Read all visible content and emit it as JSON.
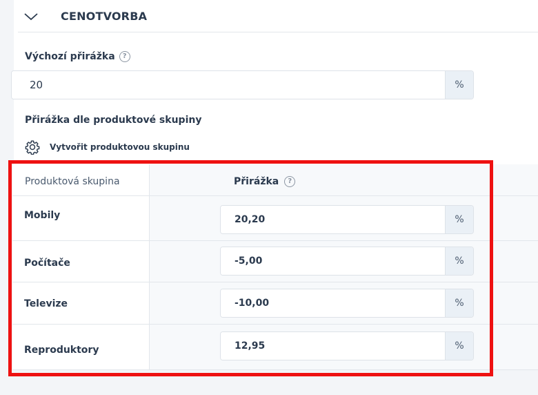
{
  "section": {
    "title": "CENOTVORBA",
    "toggle_icon": "chevron-down-icon"
  },
  "default_markup": {
    "label": "Výchozí přirážka",
    "value": "20",
    "unit": "%",
    "help_icon": "?"
  },
  "group_markup": {
    "label": "Přirážka dle produktové skupiny",
    "create_link": "Vytvořit produktovou skupinu",
    "create_icon": "gear-icon"
  },
  "table": {
    "headers": {
      "group": "Produktová skupina",
      "markup": "Přirážka",
      "help_icon": "?"
    },
    "rows": [
      {
        "name": "Mobily",
        "value": "20,20",
        "unit": "%"
      },
      {
        "name": "Počítače",
        "value": "-5,00",
        "unit": "%"
      },
      {
        "name": "Televize",
        "value": "-10,00",
        "unit": "%"
      },
      {
        "name": "Reproduktory",
        "value": "12,95",
        "unit": "%"
      }
    ]
  },
  "colors": {
    "highlight": "#ee1111",
    "unit_bg": "#eaf0f6",
    "text": "#2b3a4e"
  }
}
